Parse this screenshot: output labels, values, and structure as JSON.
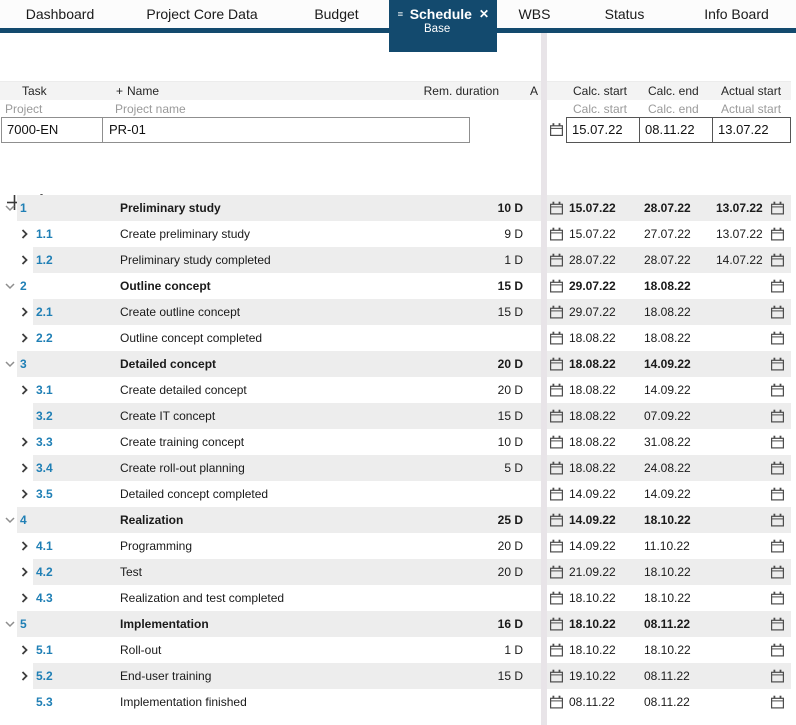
{
  "colors": {
    "accent_navy": "#134a6e",
    "link_blue": "#1f7fb5",
    "row_alt_bg": "#ededed",
    "panel_divider": "#e8e4e8"
  },
  "icons": [
    "hamburger-icon",
    "close-icon",
    "plus-icon",
    "gear-icon",
    "calendar-icon",
    "chevron-down-icon",
    "chevron-right-icon"
  ],
  "tabbar": {
    "tabs": [
      {
        "label": "Dashboard",
        "active": false
      },
      {
        "label": "Project Core Data",
        "active": false
      },
      {
        "label": "Budget",
        "active": false
      },
      {
        "label": "Schedule",
        "sublabel": "Base",
        "active": true
      },
      {
        "label": "WBS",
        "active": false
      },
      {
        "label": "Status",
        "active": false
      },
      {
        "label": "Info Board",
        "active": false
      }
    ]
  },
  "left_panel": {
    "columns": {
      "task": "Task",
      "plus": "+",
      "name": "Name",
      "rem_duration": "Rem. duration",
      "truncated": "A"
    },
    "project_labels": {
      "task": "Project",
      "name": "Project name"
    },
    "project_values": {
      "task": "7000-EN",
      "name": "PR-01"
    }
  },
  "right_panel": {
    "columns": {
      "calc_start": "Calc. start",
      "calc_end": "Calc. end",
      "actual_start": "Actual start"
    },
    "project_sublabels": {
      "calc_start": "Calc. start",
      "calc_end": "Calc. end",
      "actual_start": "Actual start"
    },
    "project_values": {
      "calc_start": "15.07.22",
      "calc_end": "08.11.22",
      "actual_start": "13.07.22"
    }
  },
  "tasks": [
    {
      "num": "1",
      "level": 1,
      "chevron": "down",
      "name": "Preliminary study",
      "duration": "10 D",
      "calc_start": "15.07.22",
      "calc_end": "28.07.22",
      "actual_start": "13.07.22"
    },
    {
      "num": "1.1",
      "level": 2,
      "chevron": "right",
      "name": "Create preliminary study",
      "duration": "9 D",
      "calc_start": "15.07.22",
      "calc_end": "27.07.22",
      "actual_start": "13.07.22"
    },
    {
      "num": "1.2",
      "level": 2,
      "chevron": "right",
      "name": "Preliminary study completed",
      "duration": "1 D",
      "calc_start": "28.07.22",
      "calc_end": "28.07.22",
      "actual_start": "14.07.22"
    },
    {
      "num": "2",
      "level": 1,
      "chevron": "down",
      "name": "Outline concept",
      "duration": "15 D",
      "calc_start": "29.07.22",
      "calc_end": "18.08.22",
      "actual_start": ""
    },
    {
      "num": "2.1",
      "level": 2,
      "chevron": "right",
      "name": "Create outline concept",
      "duration": "15 D",
      "calc_start": "29.07.22",
      "calc_end": "18.08.22",
      "actual_start": ""
    },
    {
      "num": "2.2",
      "level": 2,
      "chevron": "right",
      "name": "Outline concept completed",
      "duration": "",
      "calc_start": "18.08.22",
      "calc_end": "18.08.22",
      "actual_start": ""
    },
    {
      "num": "3",
      "level": 1,
      "chevron": "down",
      "name": "Detailed concept",
      "duration": "20 D",
      "calc_start": "18.08.22",
      "calc_end": "14.09.22",
      "actual_start": ""
    },
    {
      "num": "3.1",
      "level": 2,
      "chevron": "right",
      "name": "Create detailed concept",
      "duration": "20 D",
      "calc_start": "18.08.22",
      "calc_end": "14.09.22",
      "actual_start": ""
    },
    {
      "num": "3.2",
      "level": 2,
      "chevron": "none",
      "name": "Create IT concept",
      "duration": "15 D",
      "calc_start": "18.08.22",
      "calc_end": "07.09.22",
      "actual_start": ""
    },
    {
      "num": "3.3",
      "level": 2,
      "chevron": "right",
      "name": "Create training concept",
      "duration": "10 D",
      "calc_start": "18.08.22",
      "calc_end": "31.08.22",
      "actual_start": ""
    },
    {
      "num": "3.4",
      "level": 2,
      "chevron": "right",
      "name": "Create roll-out planning",
      "duration": "5 D",
      "calc_start": "18.08.22",
      "calc_end": "24.08.22",
      "actual_start": ""
    },
    {
      "num": "3.5",
      "level": 2,
      "chevron": "right",
      "name": "Detailed concept completed",
      "duration": "",
      "calc_start": "14.09.22",
      "calc_end": "14.09.22",
      "actual_start": ""
    },
    {
      "num": "4",
      "level": 1,
      "chevron": "down",
      "name": "Realization",
      "duration": "25 D",
      "calc_start": "14.09.22",
      "calc_end": "18.10.22",
      "actual_start": ""
    },
    {
      "num": "4.1",
      "level": 2,
      "chevron": "right",
      "name": "Programming",
      "duration": "20 D",
      "calc_start": "14.09.22",
      "calc_end": "11.10.22",
      "actual_start": ""
    },
    {
      "num": "4.2",
      "level": 2,
      "chevron": "right",
      "name": "Test",
      "duration": "20 D",
      "calc_start": "21.09.22",
      "calc_end": "18.10.22",
      "actual_start": ""
    },
    {
      "num": "4.3",
      "level": 2,
      "chevron": "right",
      "name": "Realization and test completed",
      "duration": "",
      "calc_start": "18.10.22",
      "calc_end": "18.10.22",
      "actual_start": ""
    },
    {
      "num": "5",
      "level": 1,
      "chevron": "down",
      "name": "Implementation",
      "duration": "16 D",
      "calc_start": "18.10.22",
      "calc_end": "08.11.22",
      "actual_start": ""
    },
    {
      "num": "5.1",
      "level": 2,
      "chevron": "right",
      "name": "Roll-out",
      "duration": "1 D",
      "calc_start": "18.10.22",
      "calc_end": "18.10.22",
      "actual_start": ""
    },
    {
      "num": "5.2",
      "level": 2,
      "chevron": "right",
      "name": "End-user training",
      "duration": "15 D",
      "calc_start": "19.10.22",
      "calc_end": "08.11.22",
      "actual_start": ""
    },
    {
      "num": "5.3",
      "level": 2,
      "chevron": "none",
      "name": "Implementation finished",
      "duration": "",
      "calc_start": "08.11.22",
      "calc_end": "08.11.22",
      "actual_start": ""
    }
  ]
}
